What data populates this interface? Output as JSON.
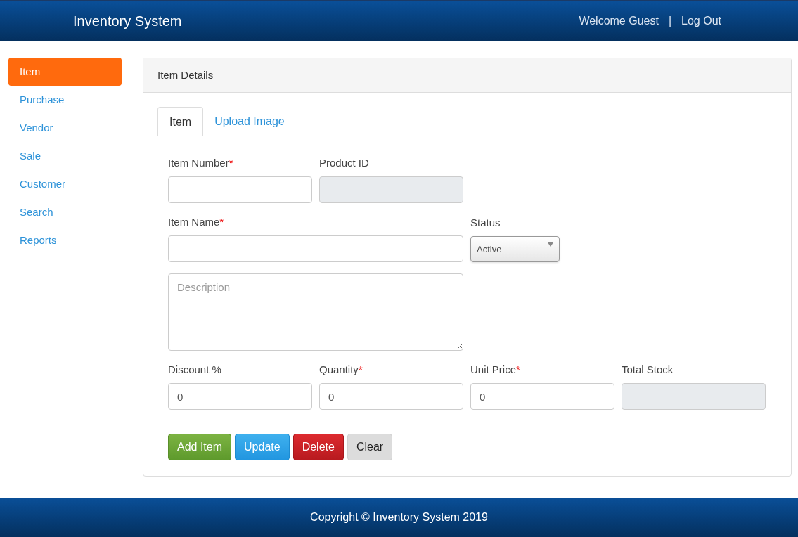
{
  "header": {
    "title": "Inventory System",
    "welcome": "Welcome Guest",
    "separator": "|",
    "logout": "Log Out"
  },
  "sidebar": {
    "items": [
      {
        "label": "Item",
        "selected": true
      },
      {
        "label": "Purchase",
        "selected": false
      },
      {
        "label": "Vendor",
        "selected": false
      },
      {
        "label": "Sale",
        "selected": false
      },
      {
        "label": "Customer",
        "selected": false
      },
      {
        "label": "Search",
        "selected": false
      },
      {
        "label": "Reports",
        "selected": false
      }
    ]
  },
  "panel": {
    "title": "Item Details",
    "tabs": [
      {
        "label": "Item",
        "selected": true
      },
      {
        "label": "Upload Image",
        "selected": false
      }
    ],
    "fields": [
      {
        "kind": "text",
        "label": "Item Number",
        "required_mark": "*"
      },
      {
        "kind": "readonly",
        "label": "Product ID"
      },
      {
        "kind": "text",
        "label": "Item Name",
        "required_mark": "*"
      },
      {
        "kind": "select",
        "label": "Status",
        "value": "Active"
      },
      {
        "kind": "textarea",
        "placeholder": "Description"
      },
      {
        "kind": "text",
        "label": "Discount %",
        "value": "0"
      },
      {
        "kind": "text",
        "label": "Quantity",
        "required_mark": "*",
        "value": "0"
      },
      {
        "kind": "text",
        "label": "Unit Price",
        "required_mark": "*",
        "value": "0"
      },
      {
        "kind": "readonly",
        "label": "Total Stock"
      }
    ],
    "buttons": [
      {
        "label": "Add Item",
        "kind": "add"
      },
      {
        "label": "Update",
        "kind": "update"
      },
      {
        "label": "Delete",
        "kind": "delete"
      },
      {
        "label": "Clear",
        "kind": "clear"
      }
    ]
  },
  "footer": {
    "text": "Copyright © Inventory System 2019"
  }
}
